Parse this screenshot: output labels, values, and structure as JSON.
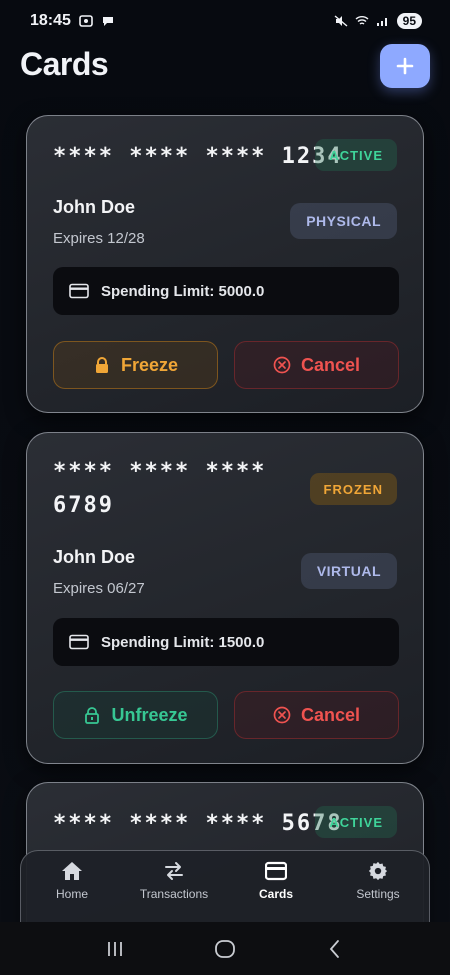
{
  "status_bar": {
    "time": "18:45",
    "battery": "95"
  },
  "header": {
    "title": "Cards",
    "add_icon": "plus-icon"
  },
  "cards": [
    {
      "number": "**** **** **** 1234",
      "status": "ACTIVE",
      "holder": "John Doe",
      "expiry": "Expires 12/28",
      "type": "PHYSICAL",
      "spending_limit": "Spending Limit: 5000.0",
      "primary_action": "Freeze",
      "secondary_action": "Cancel"
    },
    {
      "number_line1": "**** **** ****",
      "number_line2": "6789",
      "status": "FROZEN",
      "holder": "John Doe",
      "expiry": "Expires 06/27",
      "type": "VIRTUAL",
      "spending_limit": "Spending Limit: 1500.0",
      "primary_action": "Unfreeze",
      "secondary_action": "Cancel"
    },
    {
      "number": "**** **** **** 5678",
      "status": "ACTIVE"
    }
  ],
  "bottom_nav": [
    {
      "label": "Home",
      "icon": "home-icon"
    },
    {
      "label": "Transactions",
      "icon": "swap-arrows-icon"
    },
    {
      "label": "Cards",
      "icon": "card-icon",
      "active": true
    },
    {
      "label": "Settings",
      "icon": "gear-icon"
    }
  ],
  "colors": {
    "accent": "#8ea9ff",
    "active_green": "#3fd49a",
    "frozen_orange": "#f0a637",
    "cancel_red": "#ef5350"
  }
}
